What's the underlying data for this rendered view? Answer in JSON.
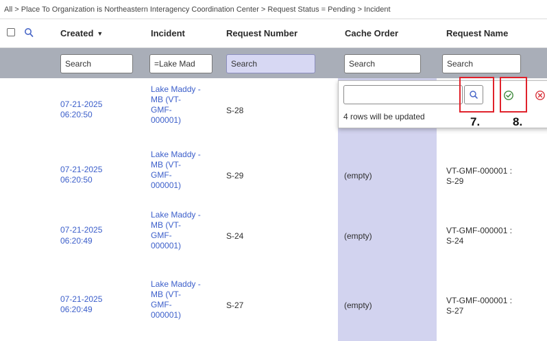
{
  "breadcrumb": "All > Place To Organization is Northeastern Interagency Coordination Center > Request Status = Pending > Incident",
  "columns": {
    "created": "Created",
    "incident": "Incident",
    "request_number": "Request Number",
    "cache_order": "Cache Order",
    "request_name": "Request Name"
  },
  "filters": {
    "created_placeholder": "Search",
    "incident_value": "=Lake Mad",
    "request_number_placeholder": "Search",
    "cache_order_placeholder": "Search",
    "request_name_placeholder": "Search"
  },
  "popup": {
    "message": "4 rows will be updated"
  },
  "callouts": {
    "search_step": "7.",
    "confirm_step": "8."
  },
  "rows": [
    {
      "created_date": "07-21-2025",
      "created_time": "06:20:50",
      "incident": [
        "Lake Maddy -",
        "MB (VT-",
        "GMF-",
        "000001)"
      ],
      "request_number": "S-28",
      "cache_order": "",
      "request_name": [
        "",
        ""
      ]
    },
    {
      "created_date": "07-21-2025",
      "created_time": "06:20:50",
      "incident": [
        "Lake Maddy -",
        "MB (VT-",
        "GMF-",
        "000001)"
      ],
      "request_number": "S-29",
      "cache_order": "(empty)",
      "request_name": [
        "VT-GMF-000001 :",
        "S-29"
      ]
    },
    {
      "created_date": "07-21-2025",
      "created_time": "06:20:49",
      "incident": [
        "Lake Maddy -",
        "MB (VT-",
        "GMF-",
        "000001)"
      ],
      "request_number": "S-24",
      "cache_order": "(empty)",
      "request_name": [
        "VT-GMF-000001 :",
        "S-24"
      ]
    },
    {
      "created_date": "07-21-2025",
      "created_time": "06:20:49",
      "incident": [
        "Lake Maddy -",
        "MB (VT-",
        "GMF-",
        "000001)"
      ],
      "request_number": "S-27",
      "cache_order": "(empty)",
      "request_name": [
        "VT-GMF-000001 :",
        "S-27"
      ]
    }
  ]
}
